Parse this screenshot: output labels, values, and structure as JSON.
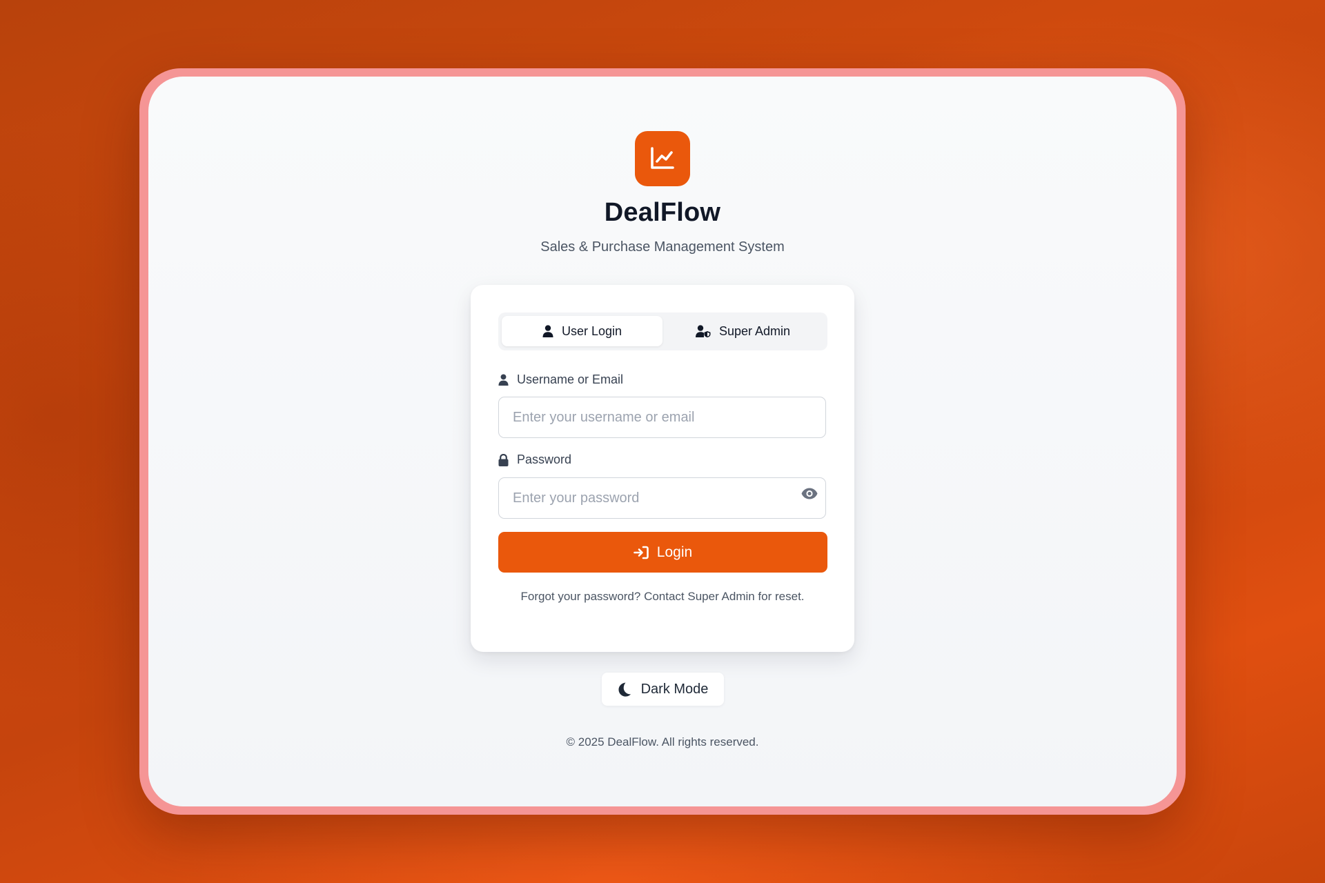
{
  "app": {
    "name": "DealFlow",
    "subtitle": "Sales & Purchase Management System",
    "logo_icon": "chart-line-icon",
    "accent_color": "#ea580c"
  },
  "tabs": [
    {
      "label": "User Login",
      "icon": "user-icon",
      "active": true
    },
    {
      "label": "Super Admin",
      "icon": "user-shield-icon",
      "active": false
    }
  ],
  "form": {
    "username": {
      "label": "Username or Email",
      "placeholder": "Enter your username or email",
      "value": "",
      "icon": "user-icon"
    },
    "password": {
      "label": "Password",
      "placeholder": "Enter your password",
      "value": "",
      "icon": "lock-icon",
      "toggle_icon": "eye-icon"
    },
    "submit_label": "Login",
    "submit_icon": "sign-in-icon",
    "forgot_text": "Forgot your password? Contact Super Admin for reset."
  },
  "theme_toggle": {
    "label": "Dark Mode",
    "icon": "moon-icon"
  },
  "footer": {
    "text": "© 2025 DealFlow. All rights reserved."
  }
}
